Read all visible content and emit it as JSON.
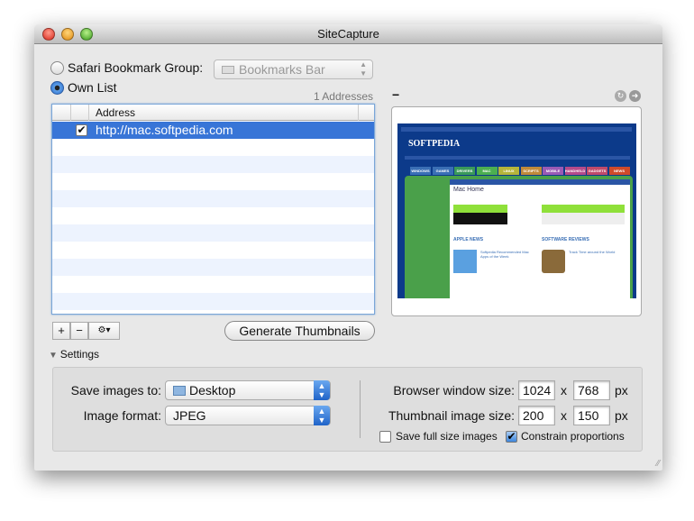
{
  "window": {
    "title": "SiteCapture"
  },
  "source": {
    "safari_label": "Safari Bookmark Group:",
    "safari_selected": false,
    "bookmark_popup": "Bookmarks Bar",
    "own_list_label": "Own List",
    "own_list_selected": true,
    "count": "1 Addresses"
  },
  "table": {
    "columns": [
      "Address"
    ],
    "rows": [
      {
        "checked": true,
        "address": "http://mac.softpedia.com",
        "selected": true
      }
    ]
  },
  "list_buttons": {
    "add": "+",
    "remove": "−",
    "gear": "⚙▾"
  },
  "generate_label": "Generate Thumbnails",
  "settings": {
    "disclosure": "Settings",
    "expanded": true,
    "save_label": "Save images to:",
    "save_value": "Desktop",
    "format_label": "Image format:",
    "format_value": "JPEG",
    "browser_label": "Browser window size:",
    "browser_w": "1024",
    "browser_h": "768",
    "thumb_label": "Thumbnail image size:",
    "thumb_w": "200",
    "thumb_h": "150",
    "x": "x",
    "px": "px",
    "save_full_label": "Save full size images",
    "save_full": false,
    "constrain_label": "Constrain proportions",
    "constrain": true
  },
  "preview": {
    "minus": "−",
    "logo": "SOFTPEDIA",
    "tabs": [
      {
        "label": "WINDOWS",
        "color": "#3a6fb5"
      },
      {
        "label": "GAMES",
        "color": "#3a6fb5"
      },
      {
        "label": "DRIVERS",
        "color": "#3a9a5a"
      },
      {
        "label": "MAC",
        "color": "#4caf50"
      },
      {
        "label": "LINUX",
        "color": "#b5b53a"
      },
      {
        "label": "SCRIPTS",
        "color": "#c08a3a"
      },
      {
        "label": "MOBILE",
        "color": "#9a5ab5"
      },
      {
        "label": "HANDHELD",
        "color": "#b54a8a"
      },
      {
        "label": "GADGETS",
        "color": "#c04a6a"
      },
      {
        "label": "NEWS",
        "color": "#d04a2a"
      }
    ],
    "page_title": "Mac Home",
    "news_heading": "APPLE NEWS",
    "reviews_heading": "SOFTWARE REVIEWS",
    "news_item": "Softpedia Recommended Mac Apps of the Week",
    "review_item": "Track Time around the World"
  }
}
